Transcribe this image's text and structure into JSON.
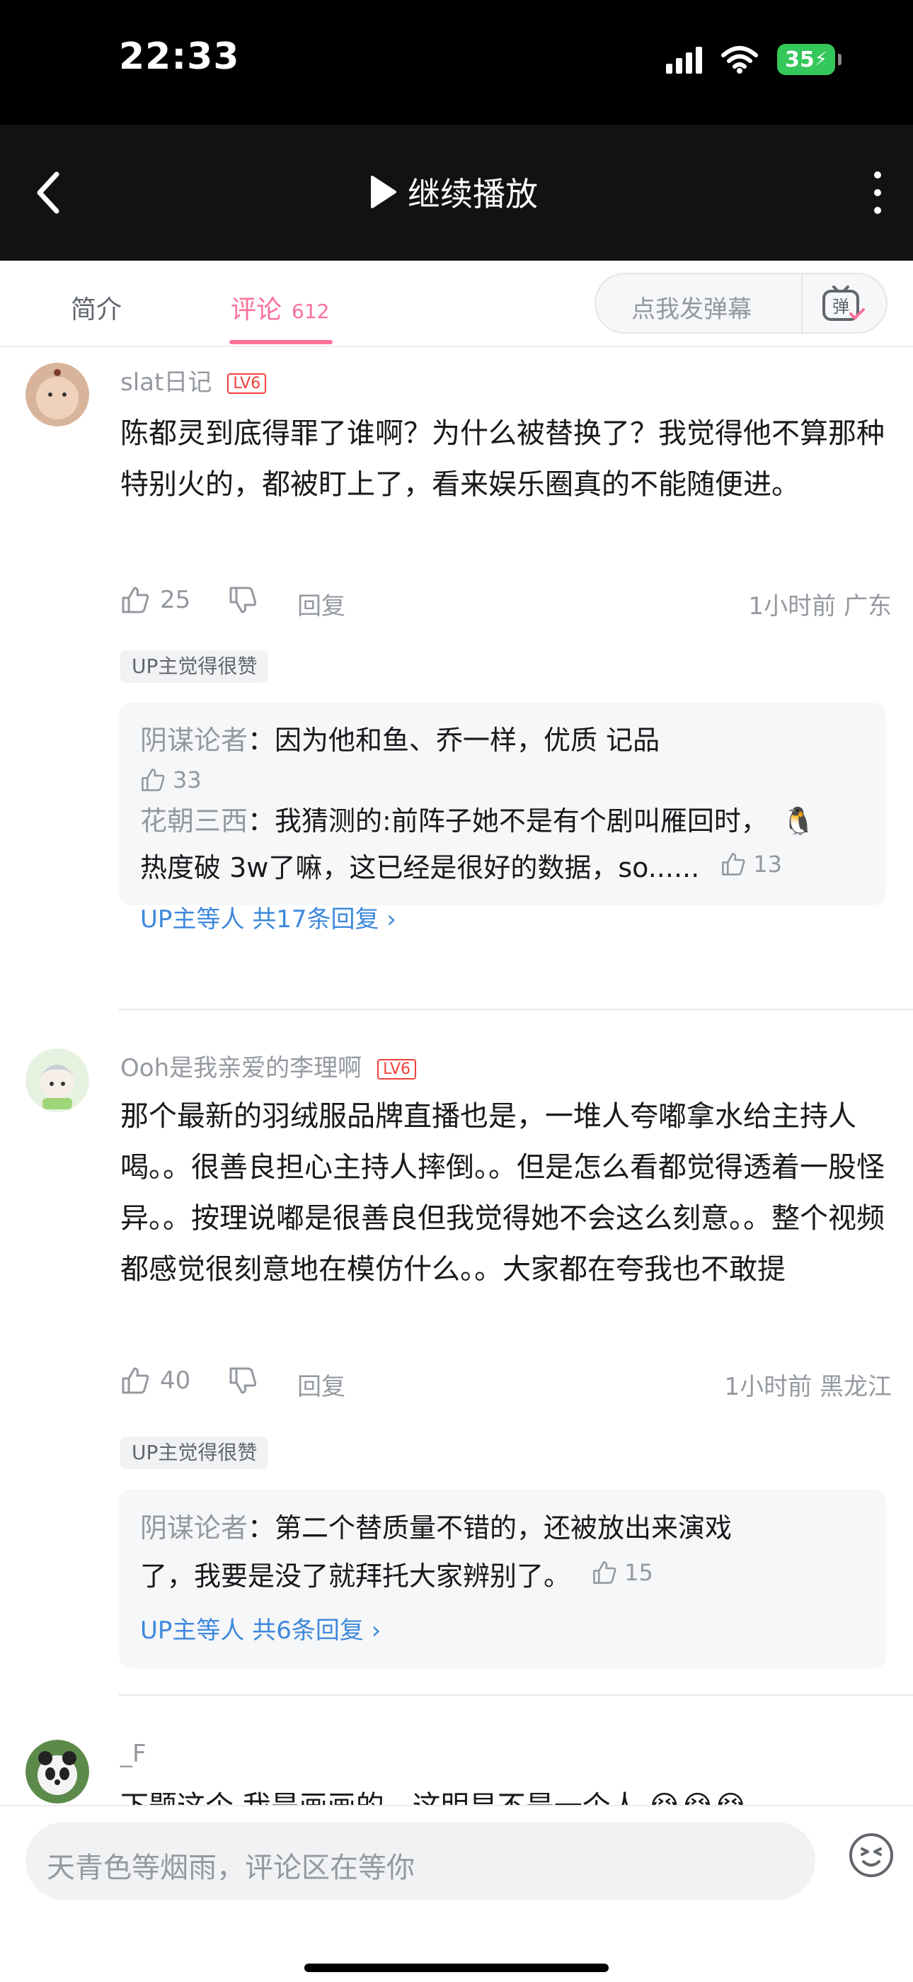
{
  "status_bar": {
    "time": "22:33",
    "battery": "35"
  },
  "nav": {
    "play_label": "继续播放"
  },
  "tabs": {
    "intro": "简介",
    "comments": "评论",
    "comment_count": "612"
  },
  "danmaku": {
    "label": "点我发弹幕",
    "icon_char": "弹"
  },
  "comments": [
    {
      "username": "slat日记",
      "text": "陈都灵到底得罪了谁啊？为什么被替换了？我觉得他不算那种特别火的，都被盯上了，看来娱乐圈真的不能随便进。",
      "likes": "25",
      "reply_label": "回复",
      "meta": "1小时前 广东",
      "badge": "UP主觉得很赞",
      "replies": [
        {
          "name": "阴谋论者",
          "text": "因为他和鱼、乔一样，优质 记品",
          "likes": "33"
        },
        {
          "name": "花朝三西",
          "text": "我猜测的:前阵子她不是有个剧叫雁回时，",
          "text2": "热度破 3w了嘛，这已经是很好的数据，so......",
          "likes": "13"
        }
      ],
      "more": "UP主等人 共17条回复 ›"
    },
    {
      "username": "Ooh是我亲爱的李理啊",
      "text": "那个最新的羽绒服品牌直播也是，一堆人夸嘟拿水给主持人喝。。很善良担心主持人摔倒。。但是怎么看都觉得透着一股怪异。。按理说嘟是很善良但我觉得她不会这么刻意。。整个视频都感觉很刻意地在模仿什么。。大家都在夸我也不敢提",
      "likes": "40",
      "reply_label": "回复",
      "meta": "1小时前 黑龙江",
      "badge": "UP主觉得很赞",
      "replies": [
        {
          "name": "阴谋论者",
          "text": "第二个替质量不错的，还被放出来演戏",
          "text2": "了，我要是没了就拜托大家辨别了。",
          "likes": "15"
        }
      ],
      "more": "UP主等人 共6条回复 ›"
    },
    {
      "username": "_F",
      "text": "下题这个 我是画画的，这明显不是一个人"
    }
  ],
  "bottom": {
    "placeholder": "天青色等烟雨，评论区在等你"
  },
  "colors": {
    "accent": "#fb7299",
    "link": "#3e88dc",
    "nav_bg": "#121212"
  }
}
